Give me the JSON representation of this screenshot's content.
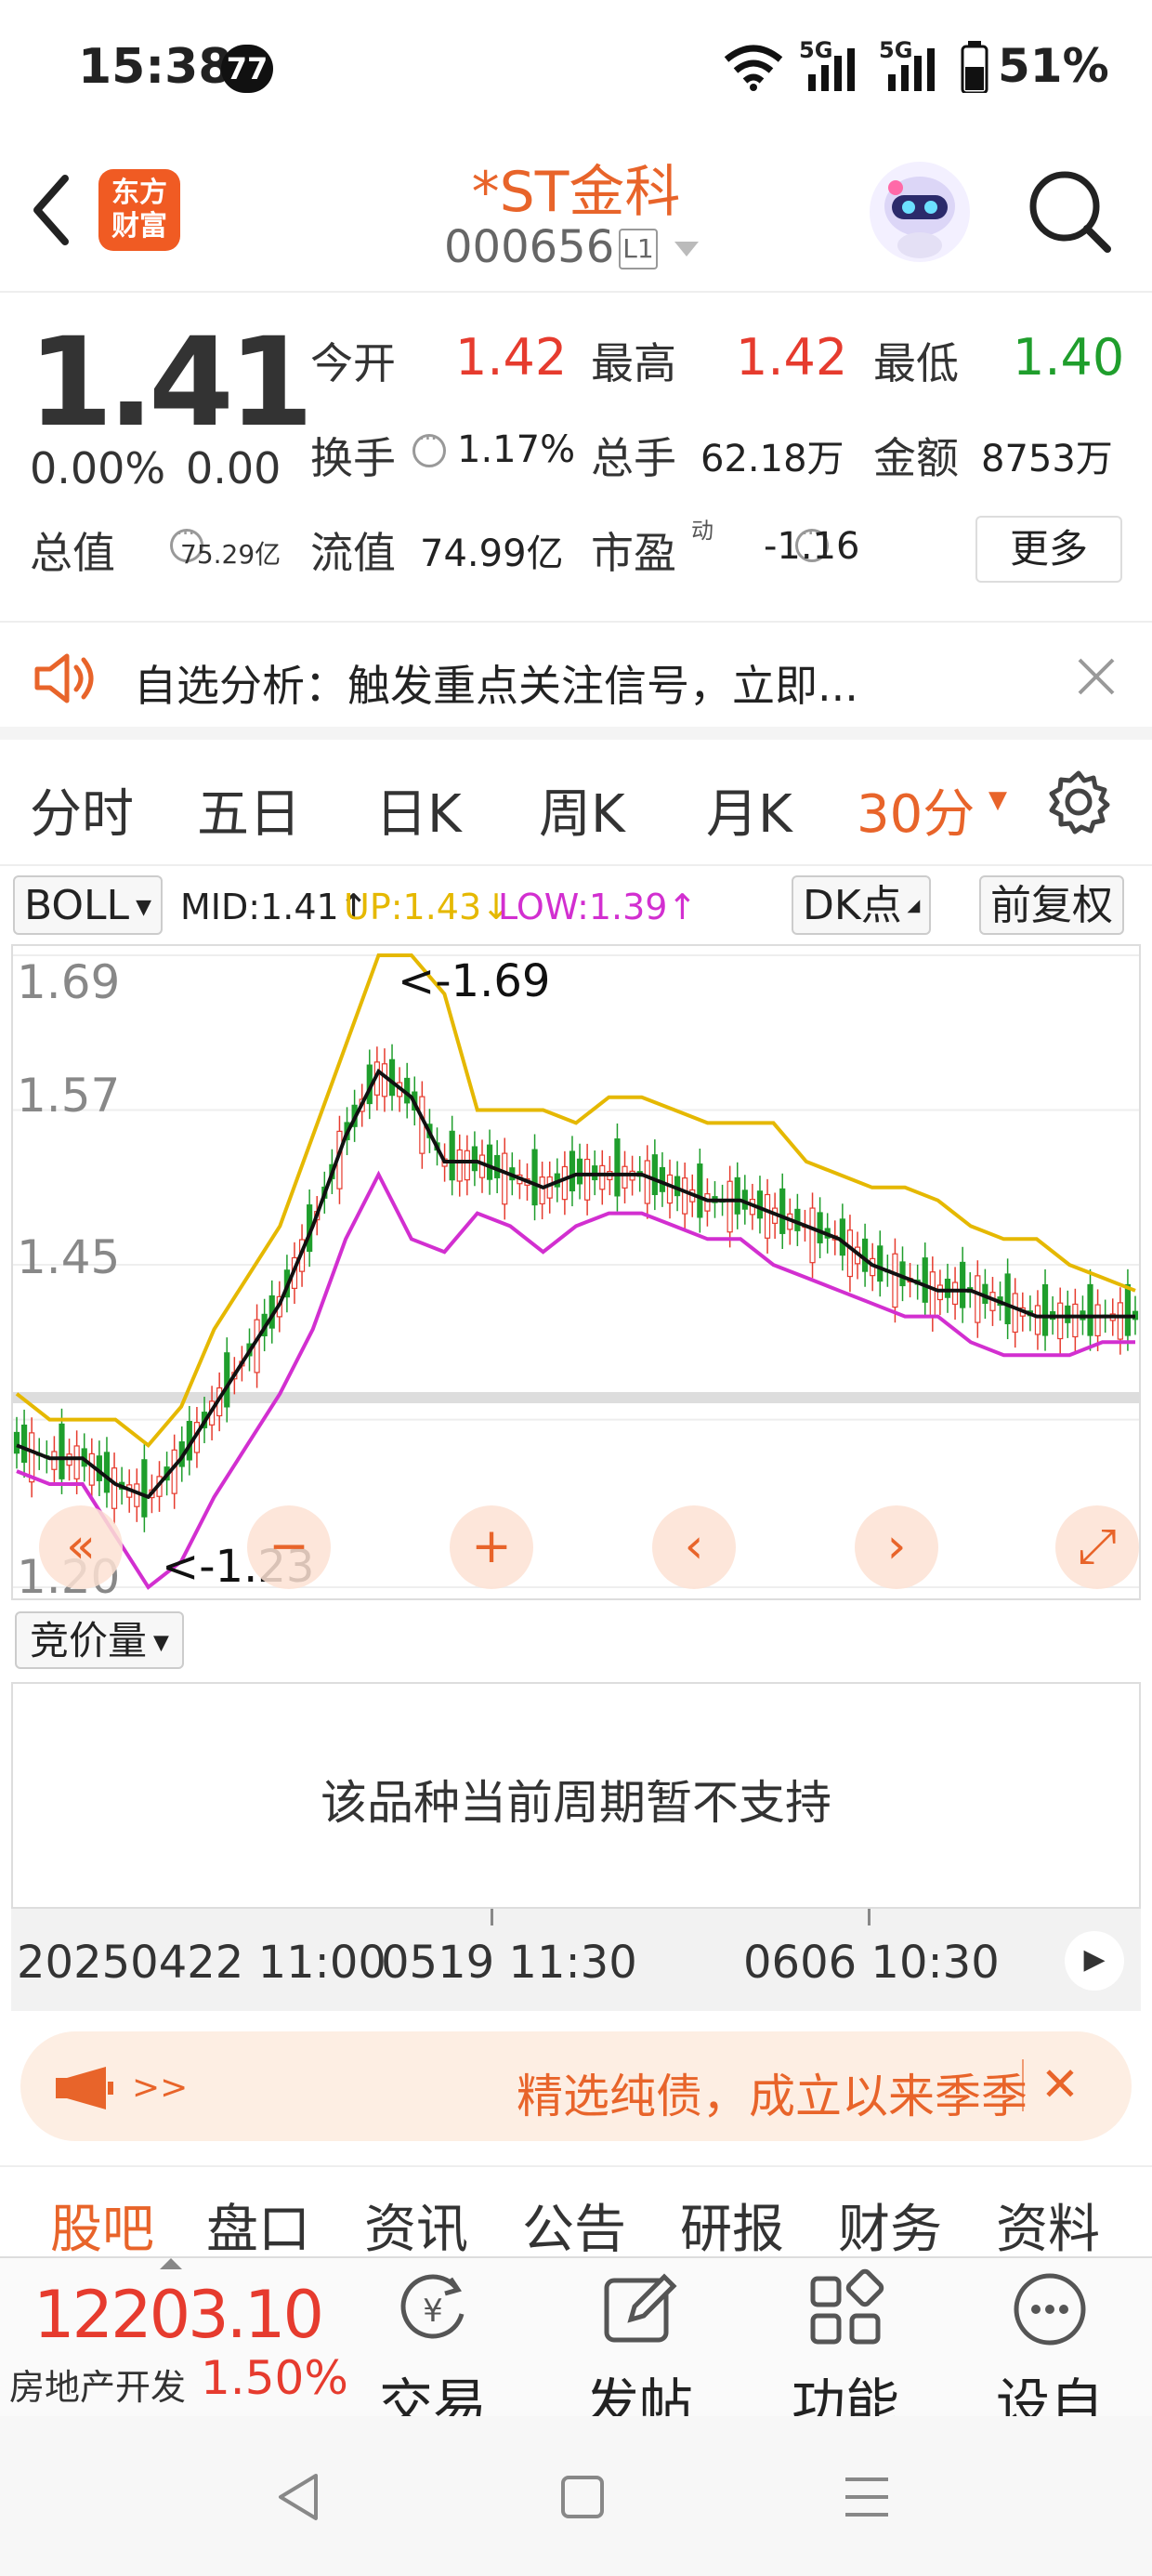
{
  "status_bar": {
    "time": "15:38",
    "badge": "77",
    "signal1": "5G",
    "signal2": "5G",
    "battery": "51%"
  },
  "header": {
    "logo_line1": "东方",
    "logo_line2": "财富",
    "title": "*ST金科",
    "code": "000656",
    "level": "L1"
  },
  "quote": {
    "price": "1.41",
    "change_pct": "0.00%",
    "change": "0.00",
    "open_label": "今开",
    "open": "1.42",
    "high_label": "最高",
    "high": "1.42",
    "low_label": "最低",
    "low": "1.40",
    "turnover_label": "换手",
    "turnover": "1.17%",
    "volume_label": "总手",
    "volume": "62.18万",
    "amount_label": "金额",
    "amount": "8753万",
    "mcap_label": "总值",
    "mcap": "75.29亿",
    "float_label": "流值",
    "float": "74.99亿",
    "pe_label": "市盈",
    "pe_sup": "动",
    "pe": "-1.16",
    "more_label": "更多"
  },
  "notice": {
    "text": "自选分析：触发重点关注信号，立即..."
  },
  "period_tabs": [
    {
      "label": "分时"
    },
    {
      "label": "五日"
    },
    {
      "label": "日K"
    },
    {
      "label": "周K"
    },
    {
      "label": "月K"
    },
    {
      "label": "30分",
      "active": true
    }
  ],
  "indicator": {
    "boll_label": "BOLL",
    "mid": "MID:1.41↑",
    "up": "UP:1.43↓",
    "low": "LOW:1.39↑",
    "dk_label": "DK点",
    "adjust_label": "前复权"
  },
  "chart_data": {
    "type": "line",
    "ylim": [
      1.2,
      1.69
    ],
    "ytick_labels": [
      "1.69",
      "1.57",
      "1.45",
      "1.20"
    ],
    "max_label": "<-1.69",
    "min_label": "<-1.23",
    "series": [
      {
        "name": "UP",
        "color": "#e5b800",
        "values": [
          1.35,
          1.33,
          1.33,
          1.33,
          1.31,
          1.34,
          1.4,
          1.44,
          1.48,
          1.55,
          1.62,
          1.69,
          1.69,
          1.66,
          1.57,
          1.57,
          1.57,
          1.56,
          1.58,
          1.58,
          1.57,
          1.56,
          1.56,
          1.56,
          1.53,
          1.52,
          1.51,
          1.51,
          1.5,
          1.48,
          1.47,
          1.47,
          1.45,
          1.44,
          1.43
        ]
      },
      {
        "name": "MID",
        "color": "#111111",
        "values": [
          1.31,
          1.3,
          1.3,
          1.28,
          1.27,
          1.3,
          1.34,
          1.38,
          1.42,
          1.48,
          1.55,
          1.6,
          1.58,
          1.53,
          1.53,
          1.52,
          1.51,
          1.52,
          1.52,
          1.52,
          1.51,
          1.5,
          1.5,
          1.49,
          1.48,
          1.47,
          1.45,
          1.44,
          1.43,
          1.43,
          1.42,
          1.41,
          1.41,
          1.41,
          1.41
        ]
      },
      {
        "name": "LOW",
        "color": "#d22fd0",
        "values": [
          1.29,
          1.28,
          1.28,
          1.24,
          1.2,
          1.22,
          1.27,
          1.31,
          1.35,
          1.4,
          1.47,
          1.52,
          1.47,
          1.46,
          1.49,
          1.48,
          1.46,
          1.48,
          1.49,
          1.49,
          1.48,
          1.47,
          1.47,
          1.45,
          1.44,
          1.43,
          1.42,
          1.41,
          1.41,
          1.39,
          1.38,
          1.38,
          1.38,
          1.39,
          1.39
        ]
      }
    ]
  },
  "chart_controls": [
    "«",
    "−",
    "+",
    "‹",
    "›",
    "⤢"
  ],
  "volume": {
    "selector": "竞价量",
    "message": "该品种当前周期暂不支持"
  },
  "time_axis": {
    "start": "20250422 11:00",
    "mid": "0519 11:30",
    "end": "0606 10:30"
  },
  "ad": {
    "arrow": ">>",
    "text": "精选纯债，成立以来季季",
    "close": "✕"
  },
  "content_tabs": [
    {
      "label": "股吧",
      "active": true
    },
    {
      "label": "盘口"
    },
    {
      "label": "资讯"
    },
    {
      "label": "公告"
    },
    {
      "label": "研报"
    },
    {
      "label": "财务"
    },
    {
      "label": "资料"
    }
  ],
  "toolbar": {
    "index_value": "12203.10",
    "index_name": "房地产开发",
    "index_change": "1.50%",
    "trade": "交易",
    "post": "发帖",
    "function": "功能",
    "watch": "设自选"
  }
}
